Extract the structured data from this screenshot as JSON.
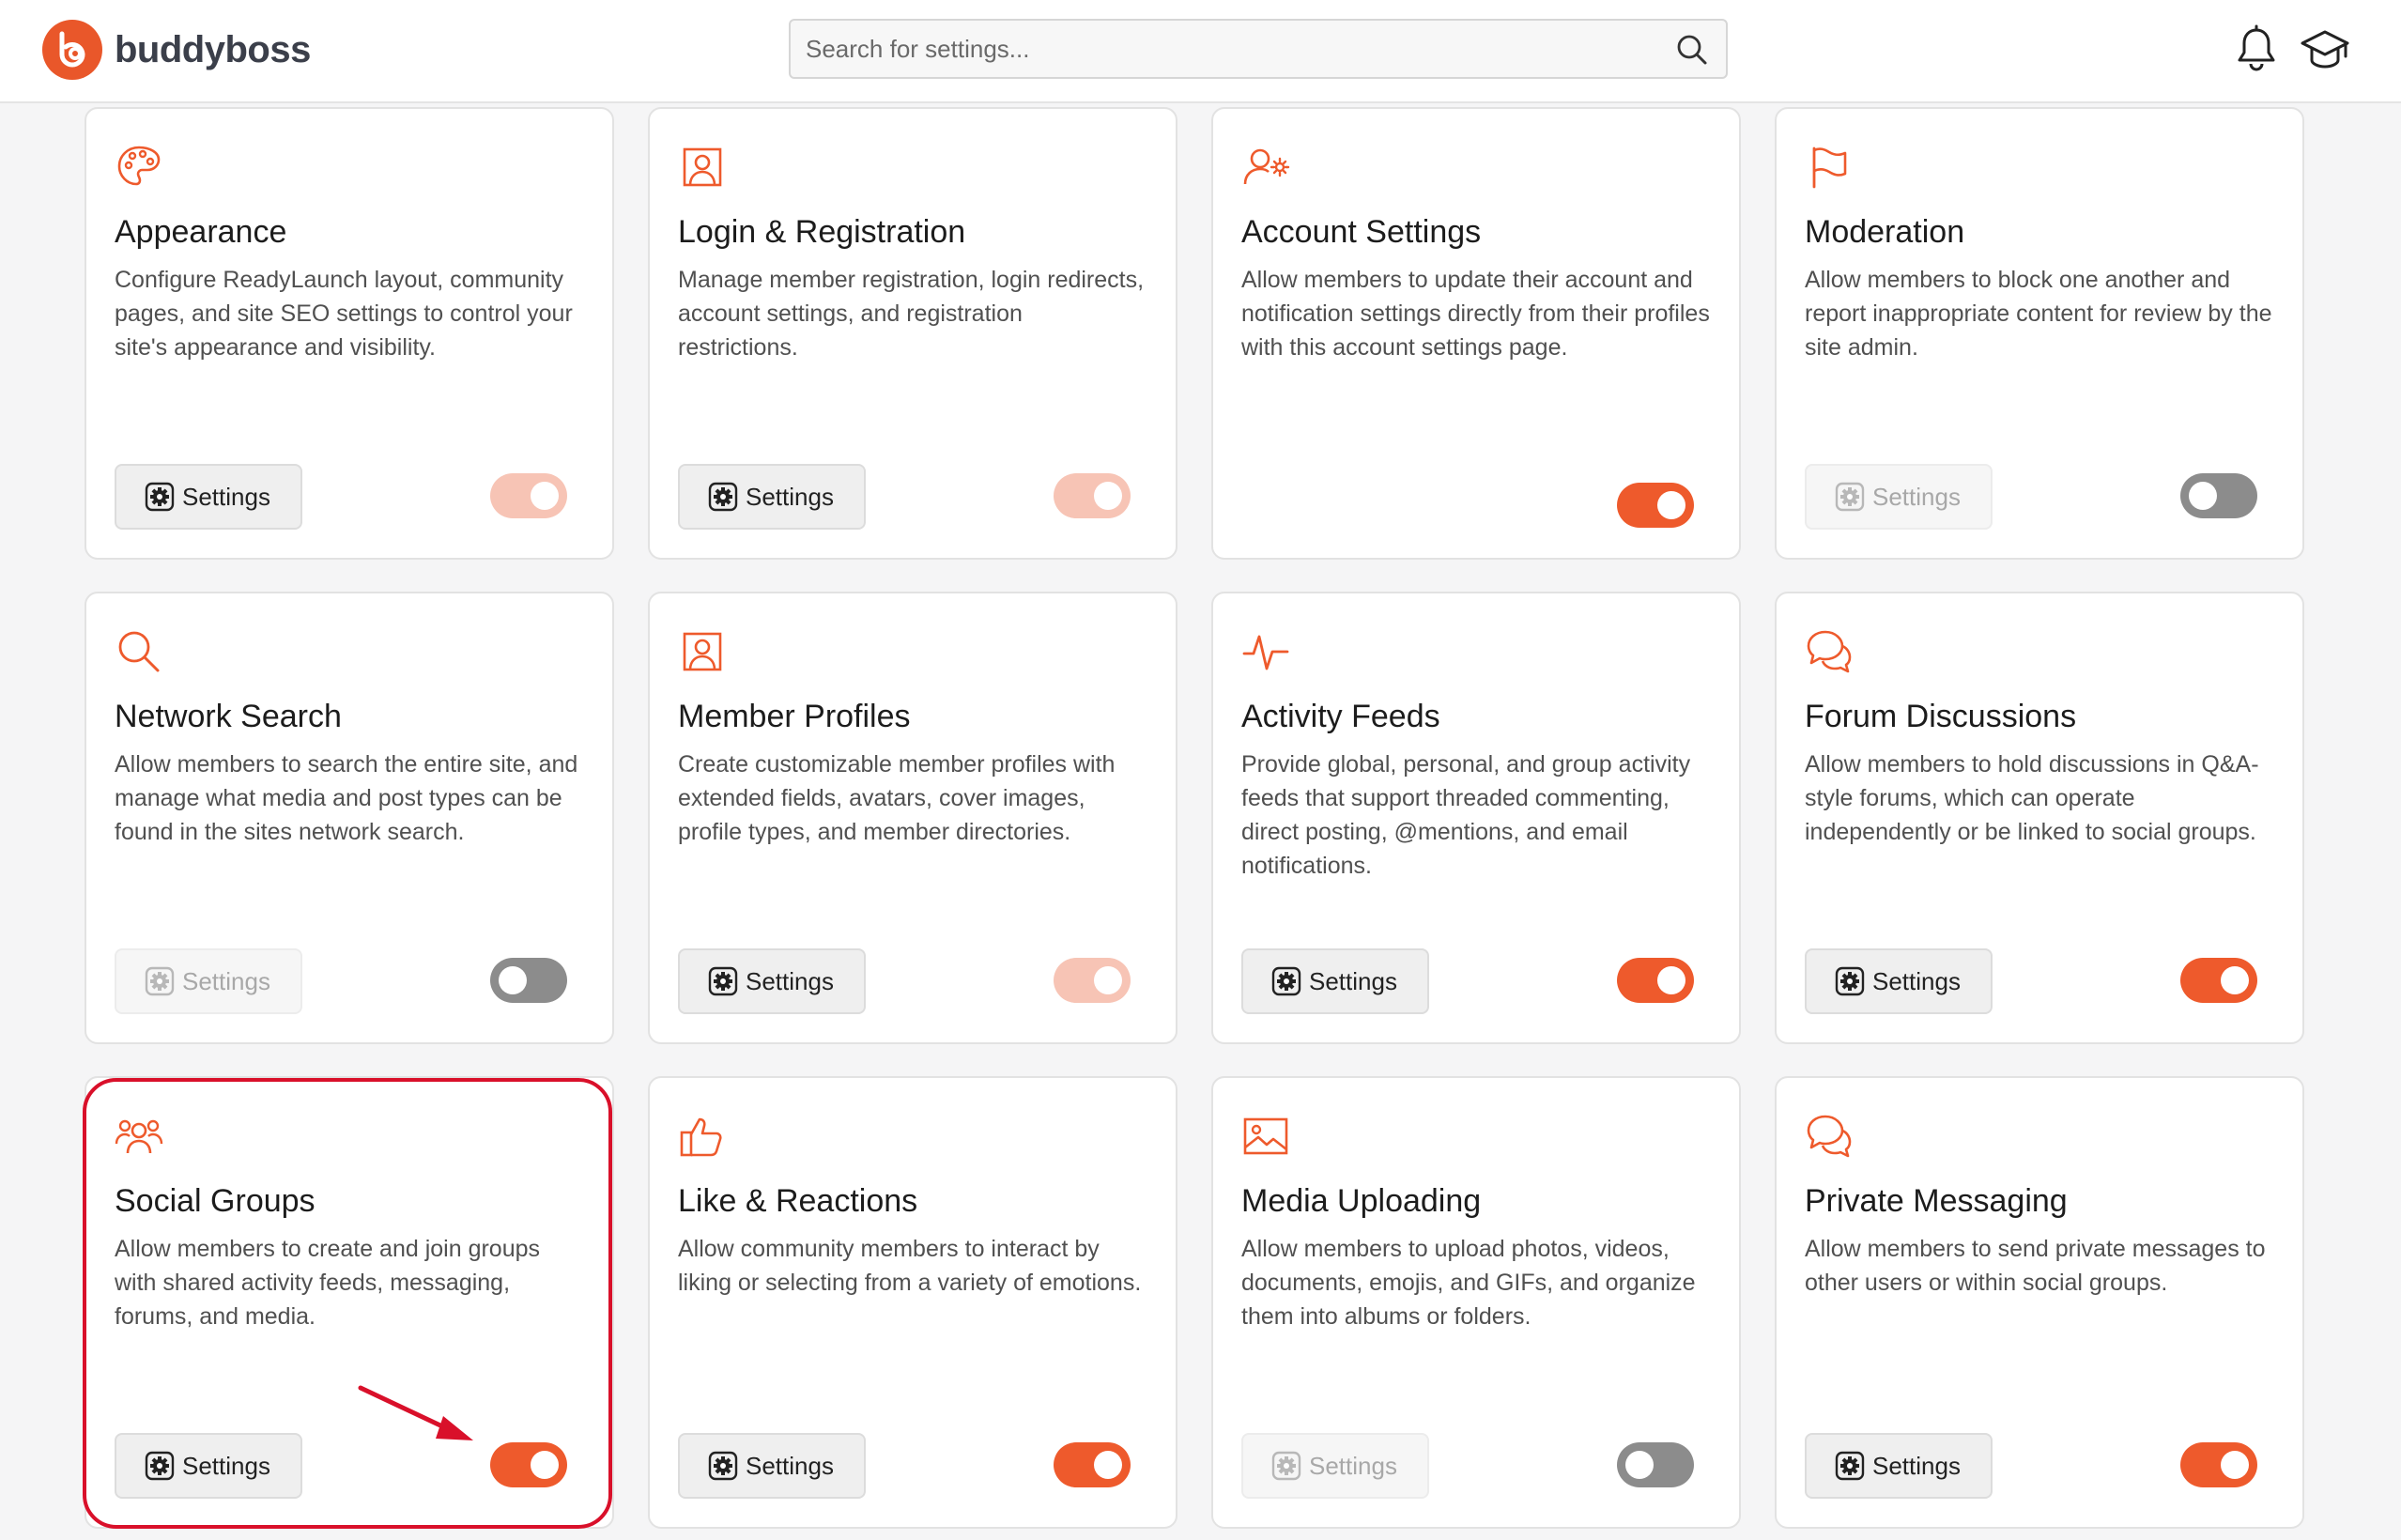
{
  "header": {
    "logo_text": "buddyboss",
    "search_placeholder": "Search for settings...",
    "icons": [
      "bell-icon",
      "graduation-cap-icon"
    ]
  },
  "colors": {
    "accent": "#ee5a2c",
    "accent_dim": "#f7c4b5",
    "toggle_off": "#8c8c8c",
    "highlight": "#d9102a"
  },
  "cards": [
    {
      "icon": "palette-icon",
      "title": "Appearance",
      "description": "Configure ReadyLaunch layout, community pages, and site SEO settings to control your site's appearance and visibility.",
      "settings_label": "Settings",
      "settings_enabled": true,
      "toggle_state": "on-disabled"
    },
    {
      "icon": "user-portrait-icon",
      "title": "Login & Registration",
      "description": "Manage member registration, login redirects, account settings, and registration restrictions.",
      "settings_label": "Settings",
      "settings_enabled": true,
      "toggle_state": "on-disabled"
    },
    {
      "icon": "user-cog-icon",
      "title": "Account Settings",
      "description": "Allow members to update their account and notification settings directly from their profiles with this account settings page.",
      "settings_label": "",
      "settings_enabled": false,
      "toggle_state": "on"
    },
    {
      "icon": "flag-icon",
      "title": "Moderation",
      "description": "Allow members to block one another and report inappropriate content for review by the site admin.",
      "settings_label": "Settings",
      "settings_enabled": false,
      "toggle_state": "off"
    },
    {
      "icon": "search-icon",
      "title": "Network Search",
      "description": "Allow members to search the entire site, and manage what media and post types can be found in the sites network search.",
      "settings_label": "Settings",
      "settings_enabled": false,
      "toggle_state": "off"
    },
    {
      "icon": "user-portrait-icon",
      "title": "Member Profiles",
      "description": "Create customizable member profiles with extended fields, avatars, cover images, profile types, and member directories.",
      "settings_label": "Settings",
      "settings_enabled": true,
      "toggle_state": "on-disabled"
    },
    {
      "icon": "activity-icon",
      "title": "Activity Feeds",
      "description": "Provide global, personal, and group activity feeds that support threaded commenting, direct posting, @mentions, and email notifications.",
      "settings_label": "Settings",
      "settings_enabled": true,
      "toggle_state": "on"
    },
    {
      "icon": "chat-bubbles-icon",
      "title": "Forum Discussions",
      "description": "Allow members to hold discussions in Q&A-style forums, which can operate independently or be linked to social groups.",
      "settings_label": "Settings",
      "settings_enabled": true,
      "toggle_state": "on"
    },
    {
      "icon": "users-group-icon",
      "title": "Social Groups",
      "description": "Allow members to create and join groups with shared activity feeds, messaging, forums, and media.",
      "settings_label": "Settings",
      "settings_enabled": true,
      "toggle_state": "on"
    },
    {
      "icon": "thumbs-up-icon",
      "title": "Like & Reactions",
      "description": "Allow community members to interact by liking or selecting from a variety of emotions.",
      "settings_label": "Settings",
      "settings_enabled": true,
      "toggle_state": "on"
    },
    {
      "icon": "image-icon",
      "title": "Media Uploading",
      "description": "Allow members to upload photos, videos, documents, emojis, and GIFs, and organize them into albums or folders.",
      "settings_label": "Settings",
      "settings_enabled": false,
      "toggle_state": "off"
    },
    {
      "icon": "chat-bubbles-icon",
      "title": "Private Messaging",
      "description": "Allow members to send private messages to other users or within social groups.",
      "settings_label": "Settings",
      "settings_enabled": true,
      "toggle_state": "on"
    }
  ]
}
